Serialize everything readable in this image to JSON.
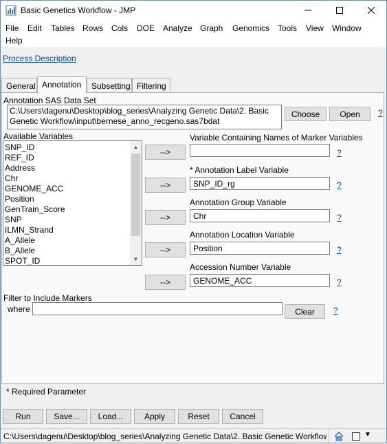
{
  "window": {
    "title": "Basic Genetics Workflow - JMP",
    "minimize": "—",
    "maximize": "☐",
    "close": "✕"
  },
  "menu": [
    {
      "label": "File"
    },
    {
      "label": "Edit"
    },
    {
      "label": "Tables"
    },
    {
      "label": "Rows"
    },
    {
      "label": "Cols"
    },
    {
      "label": "DOE"
    },
    {
      "label": "Analyze"
    },
    {
      "label": "Graph"
    },
    {
      "label": "Genomics"
    },
    {
      "label": "Tools"
    },
    {
      "label": "View"
    },
    {
      "label": "Window"
    },
    {
      "label": "Help"
    }
  ],
  "process_description": "Process Description",
  "tabs": [
    {
      "label": "General"
    },
    {
      "label": "Annotation"
    },
    {
      "label": "Subsetting"
    },
    {
      "label": "Filtering"
    }
  ],
  "annotation": {
    "dataset_label": "Annotation SAS Data Set",
    "dataset_path": "C:\\Users\\dagenu\\Desktop\\blog_series\\Analyzing Genetic Data\\2. Basic Genetic Workflow\\input\\bernese_anno_recgeno.sas7bdat",
    "choose": "Choose",
    "open": "Open",
    "help": "?"
  },
  "available_variables": {
    "label": "Available Variables",
    "items": [
      "SNP_ID",
      "REF_ID",
      "Address",
      "Chr",
      "GENOME_ACC",
      "Position",
      "GenTrain_Score",
      "SNP",
      "ILMN_Strand",
      "A_Allele",
      "B_Allele",
      "SPOT_ID"
    ]
  },
  "arrow_label": "-->",
  "fields": [
    {
      "label": "Variable Containing Names of Marker Variables",
      "value": ""
    },
    {
      "label": "* Annotation Label Variable",
      "value": "SNP_ID_rg"
    },
    {
      "label": "Annotation Group Variable",
      "value": "Chr"
    },
    {
      "label": "Annotation Location Variable",
      "value": "Position"
    },
    {
      "label": "Accession Number Variable",
      "value": "GENOME_ACC"
    }
  ],
  "filter": {
    "label": "Filter to Include Markers",
    "where": "where",
    "value": "",
    "clear": "Clear",
    "help": "?"
  },
  "required_note": "* Required Parameter",
  "buttons": {
    "run": "Run",
    "save": "Save...",
    "load": "Load...",
    "apply": "Apply",
    "reset": "Reset",
    "cancel": "Cancel"
  },
  "status": {
    "path": "C:\\Users\\dagenu\\Desktop\\blog_series\\Analyzing Genetic Data\\2. Basic Genetic Workflow"
  }
}
